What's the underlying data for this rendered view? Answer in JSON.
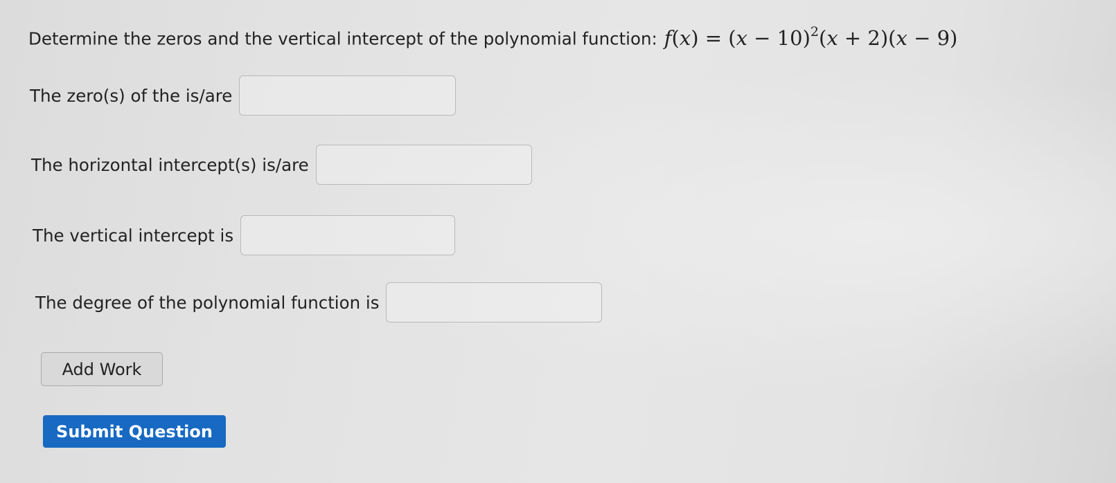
{
  "question": {
    "prompt": "Determine the zeros and the vertical intercept of the polynomial function:",
    "function": {
      "f": "f",
      "open_var": "(",
      "var_x": "x",
      "close_var": ")",
      "equals": " = (",
      "x1": "x",
      "factor1_rest": " − 10)",
      "exponent": "2",
      "open2": "(",
      "x2": "x",
      "factor2_rest": " + 2)(",
      "x3": "x",
      "factor3_rest": " − 9)"
    }
  },
  "fields": {
    "zeros_label": "The zero(s) of the is/are",
    "horizontal_label": "The horizontal intercept(s) is/are",
    "vertical_label": "The vertical intercept is",
    "degree_label": "The degree of the polynomial function is"
  },
  "buttons": {
    "add_work": "Add Work",
    "submit": "Submit Question"
  },
  "colors": {
    "submit_bg": "#1769c2",
    "background": "#e4e4e4"
  }
}
